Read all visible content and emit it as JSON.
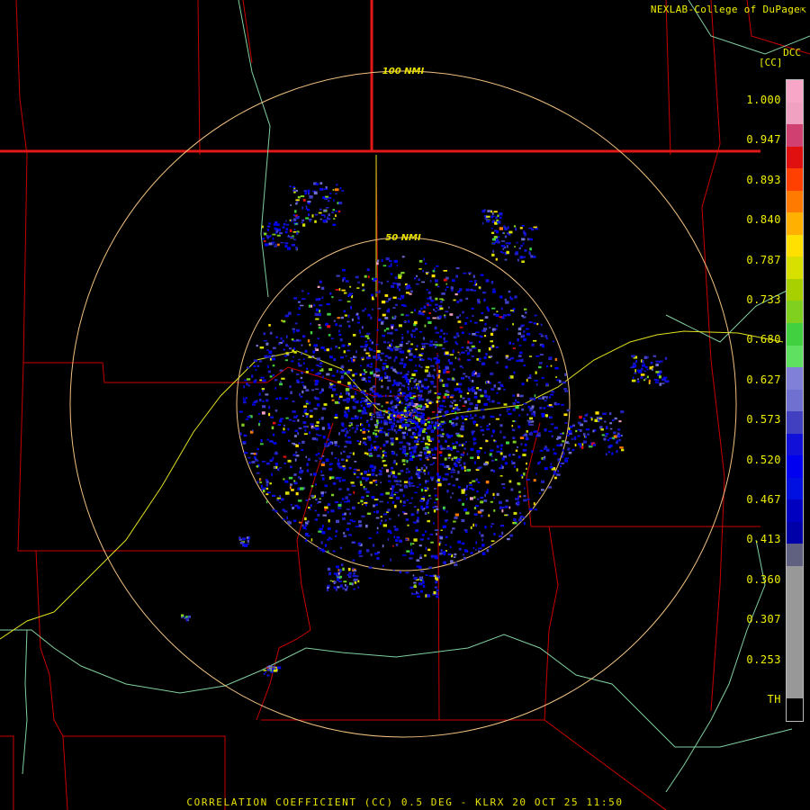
{
  "header": {
    "credit": "NEXLAB-College of DuPage",
    "credit_icon": "arrow-cursor-icon",
    "site_code": "DCC",
    "unit_label": "[CC]"
  },
  "range_rings": [
    {
      "label": "100 NMI"
    },
    {
      "label": "50 NMI"
    }
  ],
  "colorbar": {
    "ticks": [
      "1.000",
      "0.947",
      "0.893",
      "0.840",
      "0.787",
      "0.733",
      "0.680",
      "0.627",
      "0.573",
      "0.520",
      "0.467",
      "0.413",
      "0.360",
      "0.307",
      "0.253",
      "TH"
    ],
    "colors": [
      "#f7a6c8",
      "#f0a0c0",
      "#d04070",
      "#e01010",
      "#ff4000",
      "#ff7a00",
      "#ffb000",
      "#ffe000",
      "#d8e000",
      "#a8d000",
      "#80d020",
      "#40d040",
      "#60e060",
      "#8080d8",
      "#7070d0",
      "#4040c0",
      "#1010d8",
      "#0000f0",
      "#0010e0",
      "#0000c0",
      "#0000a8",
      "#606080",
      "#989898",
      "#989898",
      "#989898",
      "#989898",
      "#989898",
      "#989898",
      "#000000"
    ]
  },
  "caption": "CORRELATION COEFFICIENT (CC) 0.5 DEG - KLRX 20 OCT 25 11:50"
}
